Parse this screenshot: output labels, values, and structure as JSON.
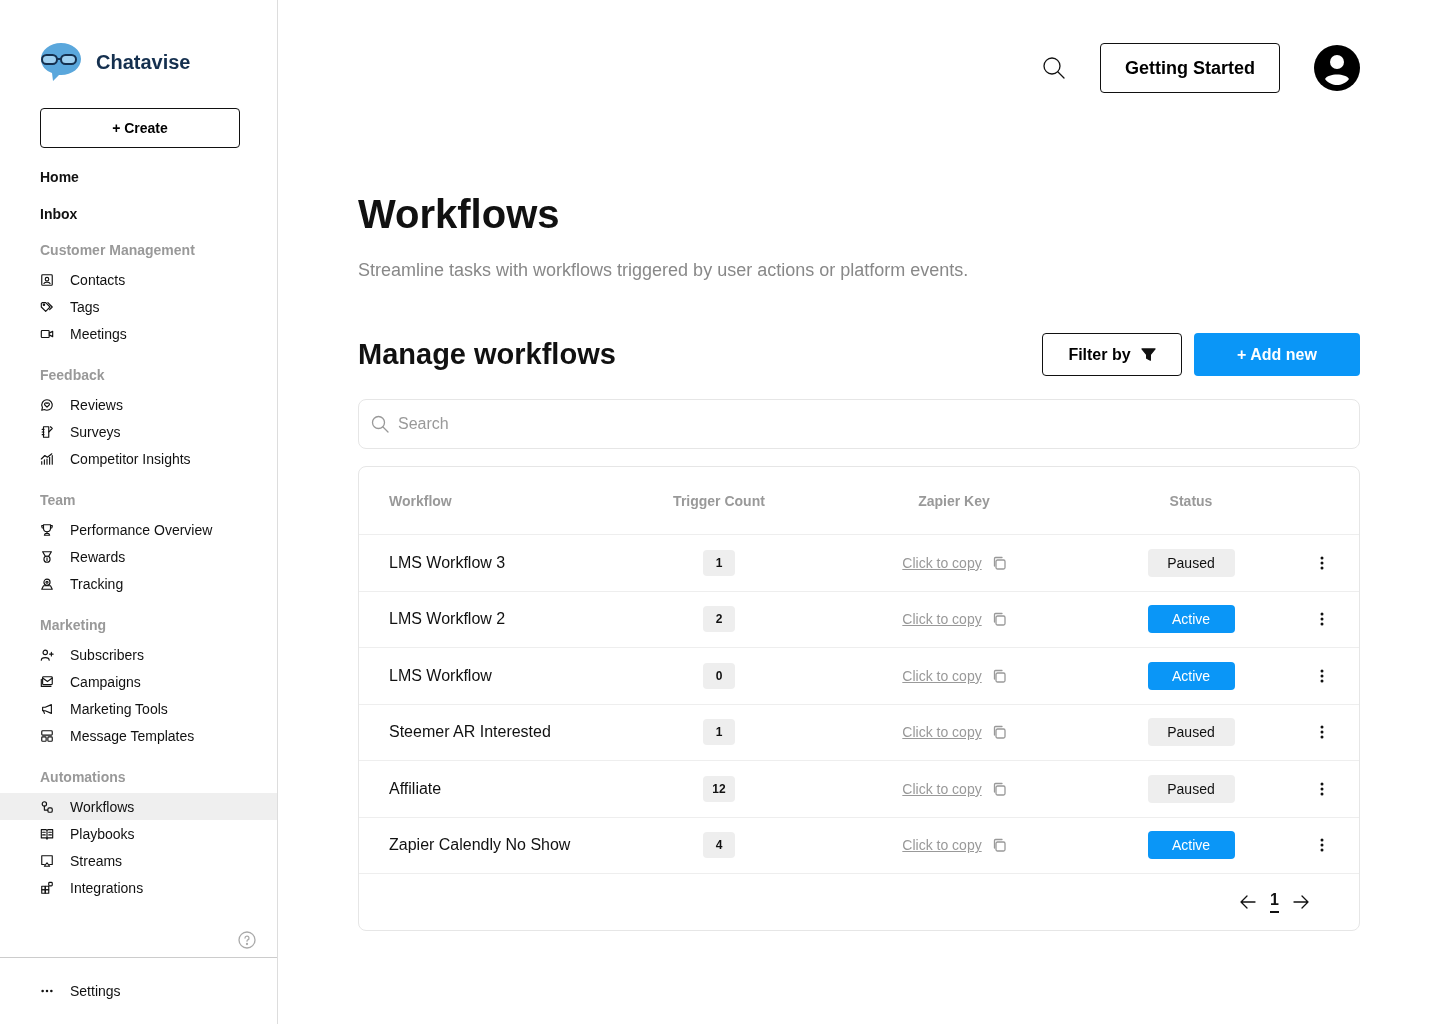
{
  "brand": {
    "name": "Chatavise"
  },
  "sidebar": {
    "create_button": "+ Create",
    "top_items": [
      {
        "label": "Home",
        "selected": false
      },
      {
        "label": "Inbox",
        "selected": false
      }
    ],
    "groups": [
      {
        "heading": "Customer Management",
        "items": [
          {
            "label": "Contacts",
            "selected": false
          },
          {
            "label": "Tags",
            "selected": false
          },
          {
            "label": "Meetings",
            "selected": false
          }
        ]
      },
      {
        "heading": "Feedback",
        "items": [
          {
            "label": "Reviews",
            "selected": false
          },
          {
            "label": "Surveys",
            "selected": false
          },
          {
            "label": "Competitor Insights",
            "selected": false
          }
        ]
      },
      {
        "heading": "Team",
        "items": [
          {
            "label": "Performance Overview",
            "selected": false
          },
          {
            "label": "Rewards",
            "selected": false
          },
          {
            "label": "Tracking",
            "selected": false
          }
        ]
      },
      {
        "heading": "Marketing",
        "items": [
          {
            "label": "Subscribers",
            "selected": false
          },
          {
            "label": "Campaigns",
            "selected": false
          },
          {
            "label": "Marketing Tools",
            "selected": false
          },
          {
            "label": "Message Templates",
            "selected": false
          }
        ]
      },
      {
        "heading": "Automations",
        "items": [
          {
            "label": "Workflows",
            "selected": true
          },
          {
            "label": "Playbooks",
            "selected": false
          },
          {
            "label": "Streams",
            "selected": false
          },
          {
            "label": "Integrations",
            "selected": false
          }
        ]
      }
    ],
    "settings": "Settings"
  },
  "header": {
    "getting_started": "Getting Started"
  },
  "page": {
    "title": "Workflows",
    "subtitle": "Streamline tasks with workflows triggered by user actions or platform events.",
    "section_title": "Manage workflows",
    "filter_button": "Filter by",
    "add_button": "+ Add new"
  },
  "search": {
    "placeholder": "Search"
  },
  "table": {
    "columns": [
      "Workflow",
      "Trigger Count",
      "Zapier Key",
      "Status"
    ],
    "rows": [
      {
        "workflow": "LMS Workflow 3",
        "trigger_count": "1",
        "zapier_key": "Click to copy",
        "status": "Paused",
        "kind": "paused"
      },
      {
        "workflow": "LMS Workflow 2",
        "trigger_count": "2",
        "zapier_key": "Click to copy",
        "status": "Active",
        "kind": "active"
      },
      {
        "workflow": "LMS Workflow",
        "trigger_count": "0",
        "zapier_key": "Click to copy",
        "status": "Active",
        "kind": "active"
      },
      {
        "workflow": "Steemer AR Interested",
        "trigger_count": "1",
        "zapier_key": "Click to copy",
        "status": "Paused",
        "kind": "paused"
      },
      {
        "workflow": "Affiliate",
        "trigger_count": "12",
        "zapier_key": "Click to copy",
        "status": "Paused",
        "kind": "paused"
      },
      {
        "workflow": "Zapier Calendly No Show",
        "trigger_count": "4",
        "zapier_key": "Click to copy",
        "status": "Active",
        "kind": "active"
      }
    ]
  },
  "pagination": {
    "pages": [
      {
        "label": "1",
        "selected": true
      }
    ]
  }
}
